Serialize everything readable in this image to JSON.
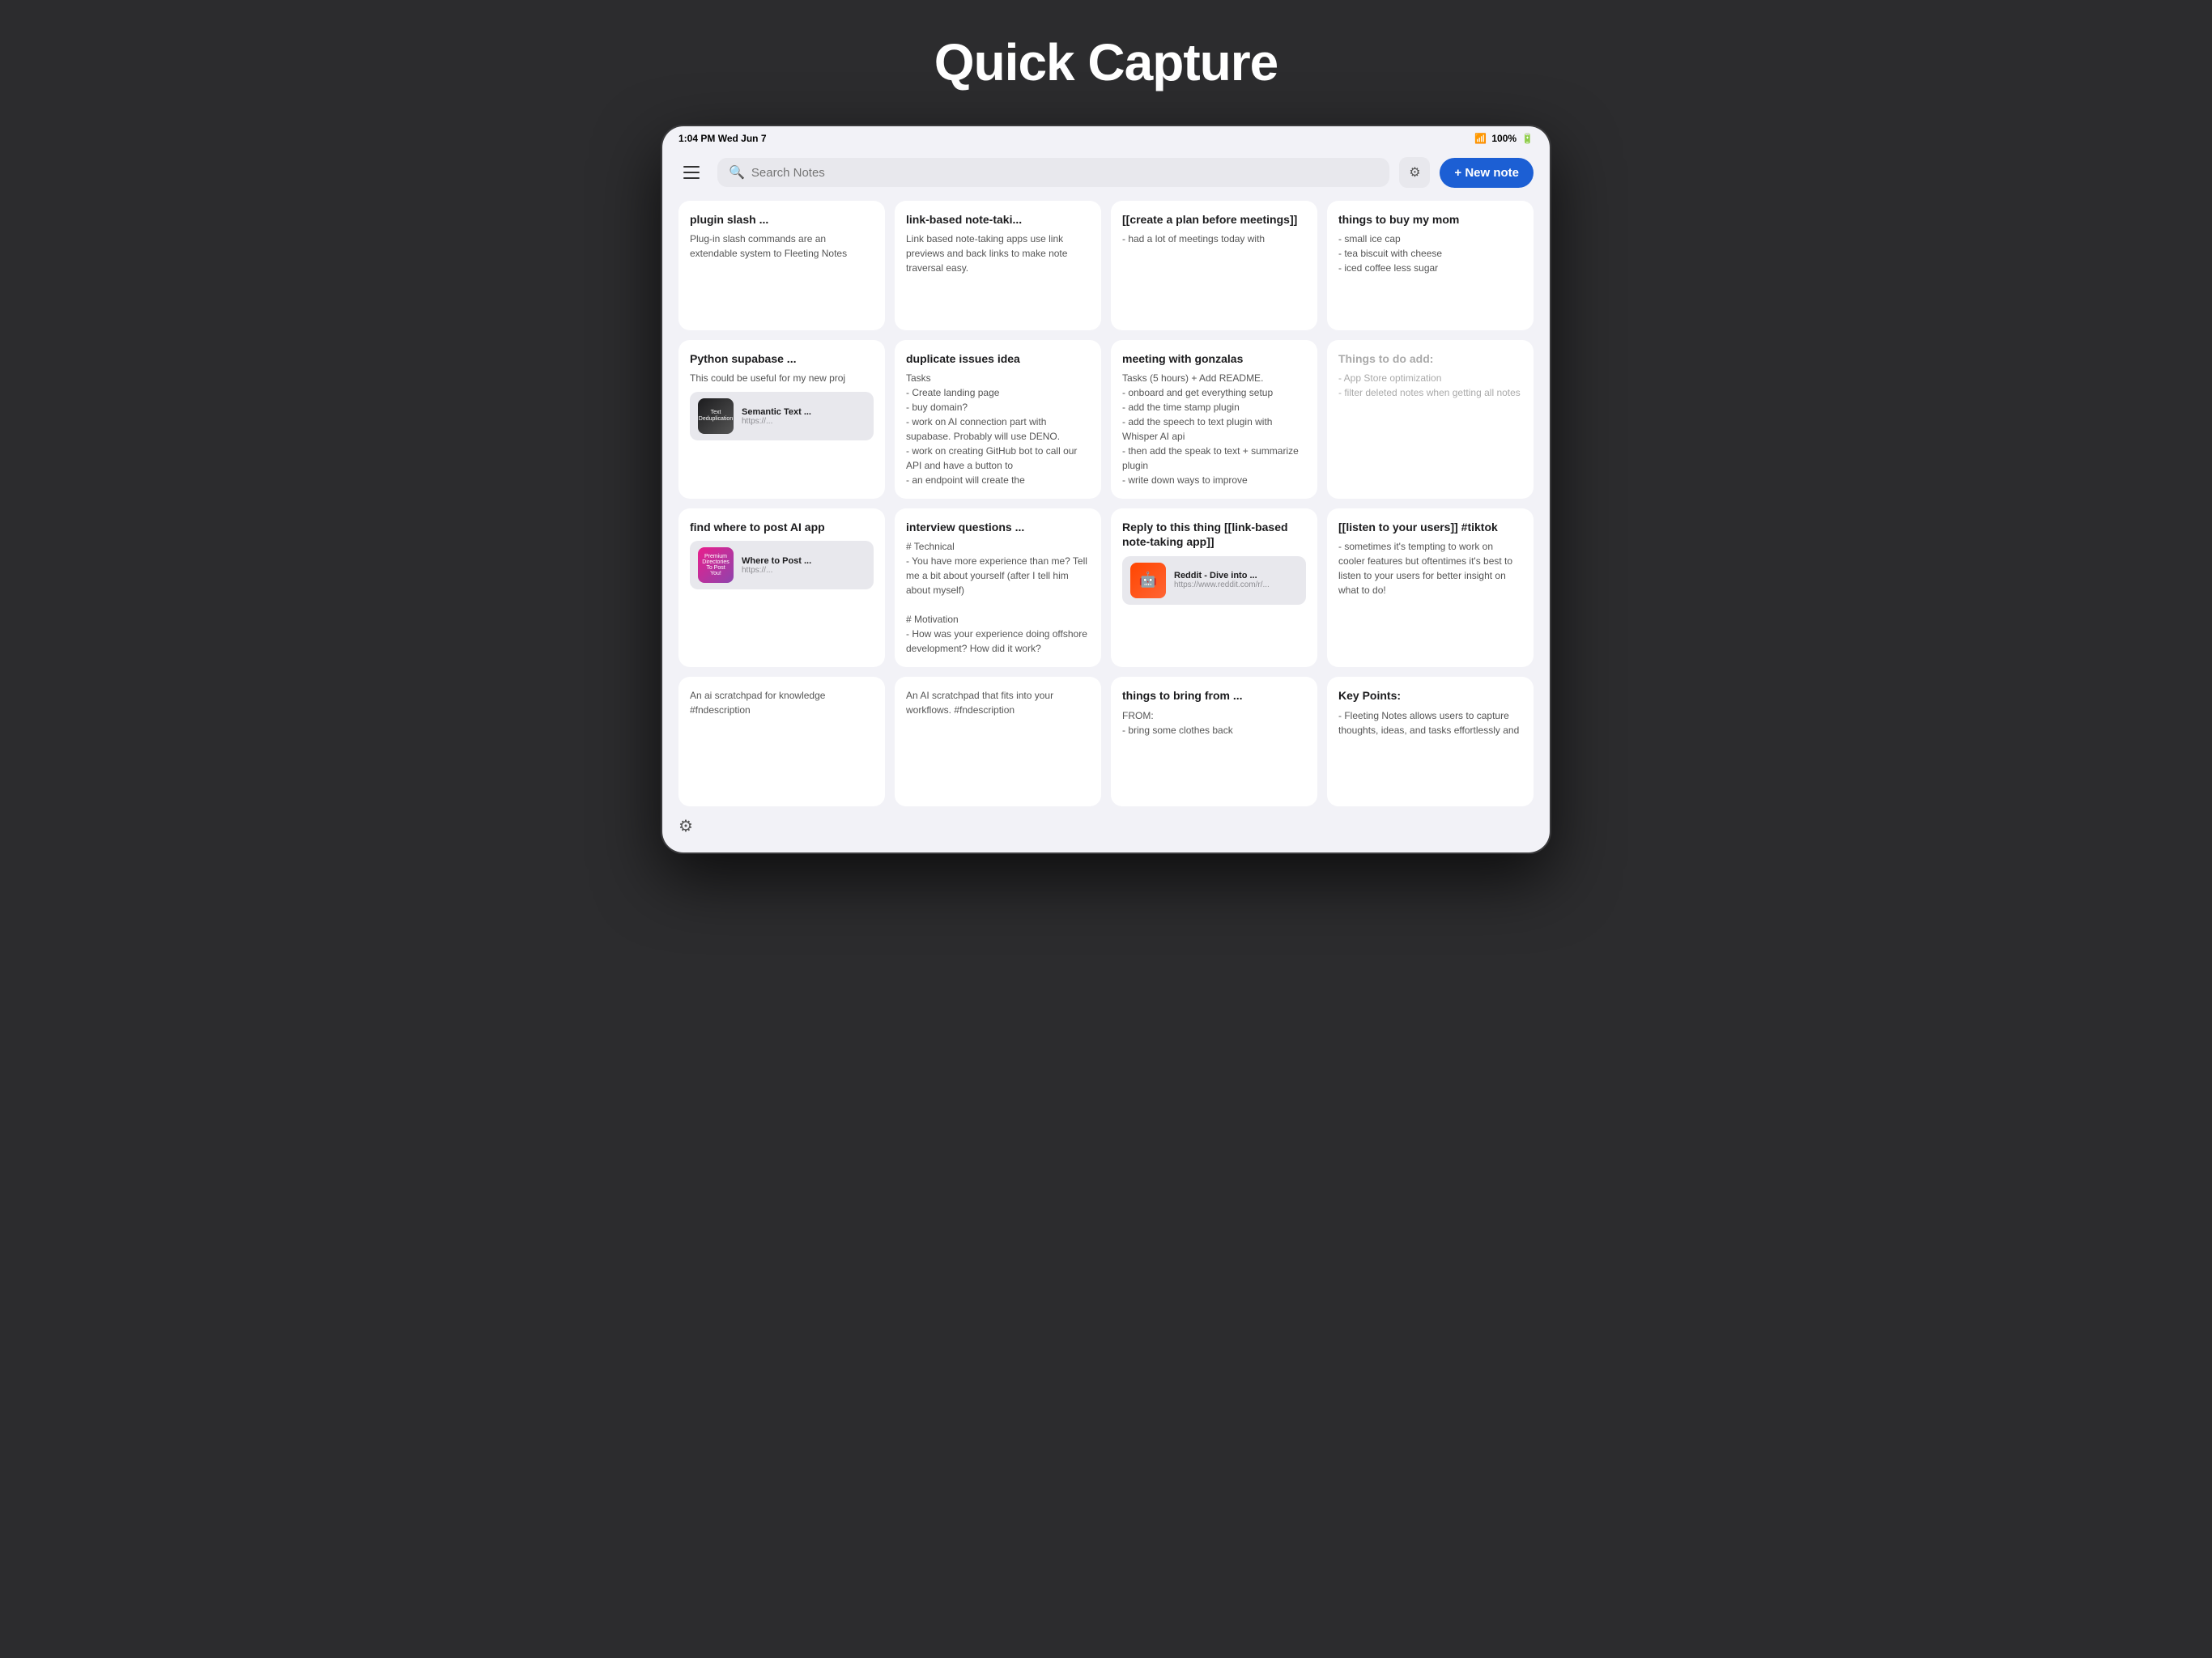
{
  "page": {
    "title": "Quick Capture"
  },
  "statusBar": {
    "time": "1:04 PM",
    "date": "Wed Jun 7",
    "battery": "100%",
    "wifi": "WiFi"
  },
  "toolbar": {
    "searchPlaceholder": "Search Notes",
    "newNoteLabel": "+ New note"
  },
  "notes": [
    {
      "id": 1,
      "title": "plugin slash ...",
      "body": "Plug-in slash commands are an extendable system to Fleeting Notes",
      "dimmed": false,
      "linkPreview": null
    },
    {
      "id": 2,
      "title": "link-based note-taki...",
      "body": "Link based note-taking apps use link previews and back links to make note traversal easy.",
      "dimmed": false,
      "linkPreview": null
    },
    {
      "id": 3,
      "title": "[[create a plan before meetings]]",
      "body": "- had a lot of meetings today with",
      "dimmed": false,
      "linkPreview": null
    },
    {
      "id": 4,
      "title": "things to buy my mom",
      "body": "- small ice cap\n- tea biscuit with cheese\n- iced coffee less sugar",
      "dimmed": false,
      "linkPreview": null
    },
    {
      "id": 5,
      "title": "Python supabase ...",
      "body": "This could be useful for my new proj",
      "dimmed": false,
      "linkPreview": {
        "type": "semantic",
        "title": "Semantic Text ...",
        "url": "https://...",
        "imgType": "semantic"
      }
    },
    {
      "id": 6,
      "title": "duplicate issues idea",
      "body": "Tasks\n- Create landing page\n- buy domain?\n- work on AI connection part with supabase. Probably will use DENO.\n- work on creating GitHub bot to call our API and have a button to\n- an endpoint will create the",
      "dimmed": false,
      "linkPreview": null
    },
    {
      "id": 7,
      "title": "meeting with gonzalas",
      "body": "Tasks (5 hours) + Add README.\n- onboard and get everything setup\n- add the time stamp plugin\n- add the speech to text plugin with Whisper AI api\n- then add the speak to text + summarize plugin\n- write down ways to improve",
      "dimmed": false,
      "linkPreview": null
    },
    {
      "id": 8,
      "title": "Things to do add:",
      "body": "- App Store optimization\n- filter deleted notes when getting all notes",
      "dimmed": true,
      "linkPreview": null
    },
    {
      "id": 9,
      "title": "find where to post AI app",
      "body": "",
      "dimmed": false,
      "linkPreview": {
        "type": "wheretopost",
        "title": "Where to Post ...",
        "url": "https://...",
        "imgType": "wheretopost"
      }
    },
    {
      "id": 10,
      "title": "interview questions ...",
      "body": "# Technical\n- You have more experience than me? Tell me a bit about yourself (after I tell him about myself)\n\n# Motivation\n- How was your experience doing offshore development? How did it work?",
      "dimmed": false,
      "linkPreview": null
    },
    {
      "id": 11,
      "title": "Reply to this thing [[link-based note-taking app]]",
      "body": "",
      "dimmed": false,
      "linkPreview": {
        "type": "reddit",
        "title": "Reddit - Dive into ...",
        "url": "https://www.reddit.com/r/...",
        "imgType": "reddit"
      }
    },
    {
      "id": 12,
      "title": "[[listen to your users]] #tiktok",
      "body": "- sometimes it's tempting to work on cooler features but oftentimes it's best to listen to your users for better insight on what to do!",
      "dimmed": false,
      "linkPreview": null
    },
    {
      "id": 13,
      "title": "",
      "body": "An ai scratchpad for knowledge #fndescription",
      "dimmed": false,
      "linkPreview": null
    },
    {
      "id": 14,
      "title": "",
      "body": "An AI scratchpad that fits into your workflows. #fndescription",
      "dimmed": false,
      "linkPreview": null
    },
    {
      "id": 15,
      "title": "things to bring from ...",
      "body": "FROM:\n- bring some clothes back",
      "dimmed": false,
      "linkPreview": null
    },
    {
      "id": 16,
      "title": "Key Points:",
      "body": "- Fleeting Notes allows users to capture thoughts, ideas, and tasks effortlessly and",
      "dimmed": false,
      "linkPreview": null
    }
  ]
}
